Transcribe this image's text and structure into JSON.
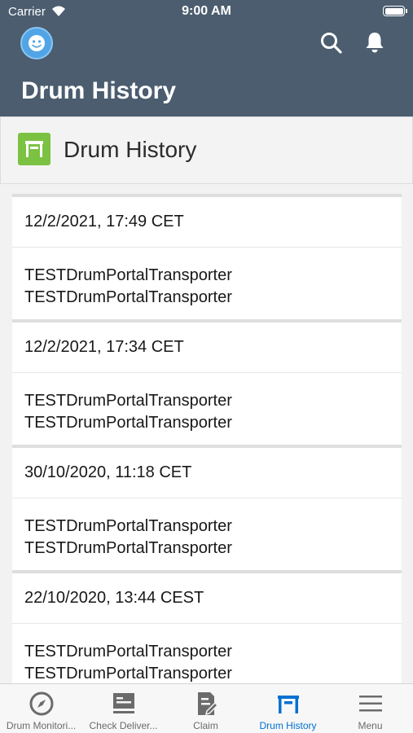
{
  "status_bar": {
    "carrier": "Carrier",
    "time": "9:00 AM"
  },
  "header": {
    "title": "Drum History"
  },
  "object_header": {
    "title": "Drum History"
  },
  "records": [
    {
      "date": "12/2/2021, 17:49 CET",
      "line1": "TESTDrumPortalTransporter",
      "line2": "TESTDrumPortalTransporter"
    },
    {
      "date": "12/2/2021, 17:34 CET",
      "line1": "TESTDrumPortalTransporter",
      "line2": "TESTDrumPortalTransporter"
    },
    {
      "date": "30/10/2020, 11:18 CET",
      "line1": "TESTDrumPortalTransporter",
      "line2": "TESTDrumPortalTransporter"
    },
    {
      "date": "22/10/2020, 13:44 CEST",
      "line1": "TESTDrumPortalTransporter",
      "line2": "TESTDrumPortalTransporter"
    }
  ],
  "tabs": [
    {
      "label": "Drum Monitori...",
      "icon": "compass-icon"
    },
    {
      "label": "Check Deliver...",
      "icon": "delivery-icon"
    },
    {
      "label": "Claim",
      "icon": "claim-icon"
    },
    {
      "label": "Drum History",
      "icon": "drum-history-icon",
      "active": true
    },
    {
      "label": "Menu",
      "icon": "menu-icon"
    }
  ],
  "colors": {
    "header_bg": "#4b5d6f",
    "accent": "#0070d2",
    "object_icon": "#7cc242"
  }
}
